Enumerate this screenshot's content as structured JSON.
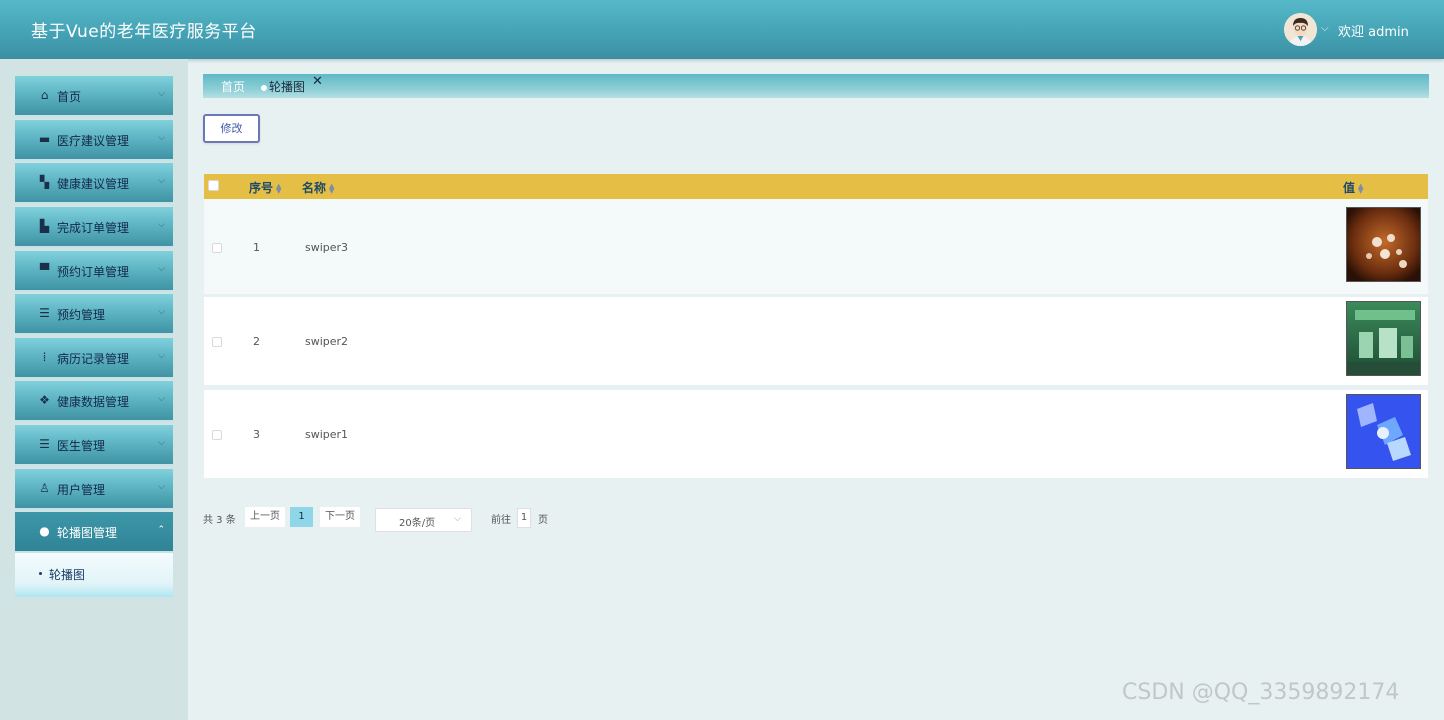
{
  "header": {
    "app_title": "基于Vue的老年医疗服务平台",
    "welcome": "欢迎 admin",
    "avatar_icon": "user-avatar-icon"
  },
  "sidebar": {
    "items": [
      {
        "label": "首页",
        "icon": "home-icon",
        "glyph": "⌂"
      },
      {
        "label": "医疗建议管理",
        "icon": "archive-icon",
        "glyph": "▬"
      },
      {
        "label": "健康建议管理",
        "icon": "dashboard-icon",
        "glyph": "▚"
      },
      {
        "label": "完成订单管理",
        "icon": "chart-bar-icon",
        "glyph": "▙"
      },
      {
        "label": "预约订单管理",
        "icon": "window-icon",
        "glyph": "▀"
      },
      {
        "label": "预约管理",
        "icon": "server-icon",
        "glyph": "☰"
      },
      {
        "label": "病历记录管理",
        "icon": "grid-icon",
        "glyph": "⁞"
      },
      {
        "label": "健康数据管理",
        "icon": "apps-icon",
        "glyph": "❖"
      },
      {
        "label": "医生管理",
        "icon": "stack-icon",
        "glyph": "☰"
      },
      {
        "label": "用户管理",
        "icon": "badge-icon",
        "glyph": "♙"
      },
      {
        "label": "轮播图管理",
        "icon": "circle-plus-icon",
        "glyph": "●"
      }
    ],
    "submenu_label": "轮播图"
  },
  "breadcrumb": {
    "home": "首页",
    "tab": "轮播图",
    "close": "✕"
  },
  "toolbar": {
    "edit_label": "修改"
  },
  "table": {
    "columns": [
      "序号",
      "名称",
      "值"
    ],
    "rows": [
      {
        "index": "1",
        "name": "swiper3",
        "image": "swiper3-thumbnail"
      },
      {
        "index": "2",
        "name": "swiper2",
        "image": "swiper2-thumbnail"
      },
      {
        "index": "3",
        "name": "swiper1",
        "image": "swiper1-thumbnail"
      }
    ]
  },
  "pagination": {
    "total": "共 3 条",
    "prev": "上一页",
    "current": "1",
    "next": "下一页",
    "page_size": "20条/页",
    "goto": "前往",
    "goto_value": "1",
    "page_suffix": "页"
  },
  "watermark": "CSDN @QQ_3359892174",
  "colors": {
    "header": "#43a1b3",
    "table_header": "#e5bf45",
    "active_page": "#8fd7e8"
  }
}
